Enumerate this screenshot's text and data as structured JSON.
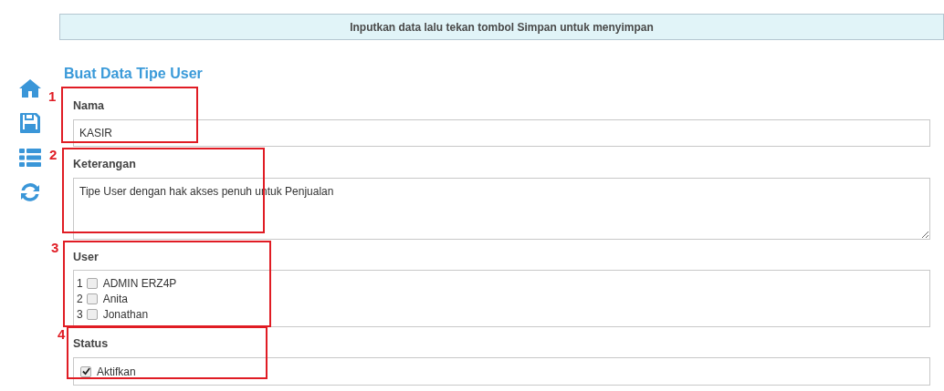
{
  "sidebar": {
    "items": [
      {
        "kind": "home"
      },
      {
        "kind": "save"
      },
      {
        "kind": "list"
      },
      {
        "kind": "refresh"
      }
    ]
  },
  "banner": {
    "text": "Inputkan data lalu tekan tombol Simpan untuk menyimpan"
  },
  "title": "Buat Data Tipe User",
  "fields": [
    {
      "kind": "text",
      "callout": "1",
      "label": "Nama",
      "value": "KASIR"
    },
    {
      "kind": "textarea",
      "callout": "2",
      "label": "Keterangan",
      "value": "Tipe User dengan hak akses penuh untuk Penjualan"
    },
    {
      "kind": "checklist",
      "callout": "3",
      "label": "User",
      "items": [
        {
          "number": "1",
          "label": "ADMIN ERZ4P",
          "checked": false
        },
        {
          "number": "2",
          "label": "Anita",
          "checked": false
        },
        {
          "number": "3",
          "label": "Jonathan",
          "checked": false
        }
      ]
    },
    {
      "kind": "checkbox",
      "callout": "4",
      "label": "Status",
      "items": [
        {
          "label": "Aktifkan",
          "checked": true
        }
      ]
    }
  ]
}
